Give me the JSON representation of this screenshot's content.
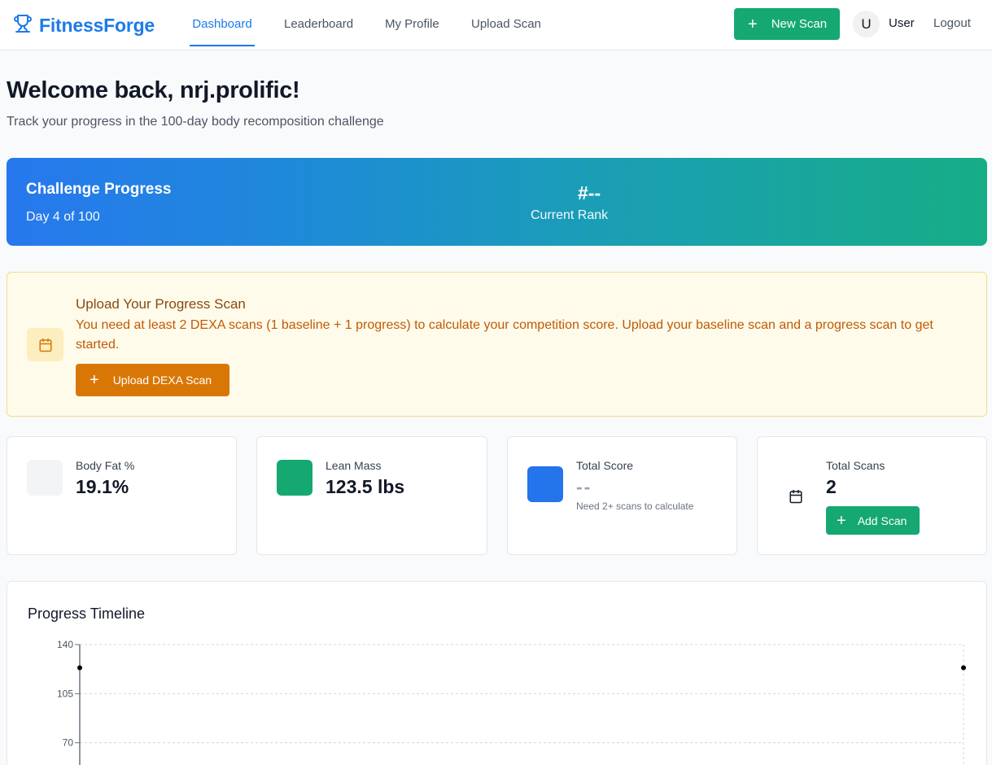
{
  "header": {
    "brand": "FitnessForge",
    "brand_icon": "trophy-icon",
    "nav": [
      {
        "label": "Dashboard",
        "active": true
      },
      {
        "label": "Leaderboard",
        "active": false
      },
      {
        "label": "My Profile",
        "active": false
      },
      {
        "label": "Upload Scan",
        "active": false
      }
    ],
    "new_scan_label": "New Scan",
    "avatar_initial": "U",
    "user_label": "User",
    "logout_label": "Logout"
  },
  "welcome": {
    "title": "Welcome back, nrj.prolific!",
    "subtitle": "Track your progress in the 100-day body recomposition challenge"
  },
  "challenge": {
    "title": "Challenge Progress",
    "day_text": "Day 4 of 100",
    "rank_value": "#--",
    "rank_label": "Current Rank"
  },
  "upload_notice": {
    "icon": "calendar-icon",
    "title": "Upload Your Progress Scan",
    "text": "You need at least 2 DEXA scans (1 baseline + 1 progress) to calculate your competition score. Upload your baseline scan and a progress scan to get started.",
    "button_label": "Upload DEXA Scan"
  },
  "stats": {
    "body_fat": {
      "label": "Body Fat %",
      "value": "19.1%",
      "color": "#f3f4f6"
    },
    "lean_mass": {
      "label": "Lean Mass",
      "value": "123.5 lbs",
      "color": "#16a871"
    },
    "total_score": {
      "label": "Total Score",
      "value": "--",
      "note": "Need 2+ scans to calculate",
      "color": "#2474eb"
    },
    "total_scans": {
      "label": "Total Scans",
      "value": "2",
      "button_label": "Add Scan",
      "icon": "calendar-icon"
    }
  },
  "colors": {
    "brand": "#1d7ae8",
    "green": "#16a871",
    "orange": "#d97706"
  },
  "chart_data": {
    "type": "scatter",
    "title": "Progress Timeline",
    "xlabel": "",
    "ylabel": "",
    "y_ticks": [
      70,
      105,
      140
    ],
    "ylim": [
      35,
      140
    ],
    "grid": true,
    "series": [
      {
        "values": [
          123.5,
          123.5
        ]
      }
    ]
  }
}
